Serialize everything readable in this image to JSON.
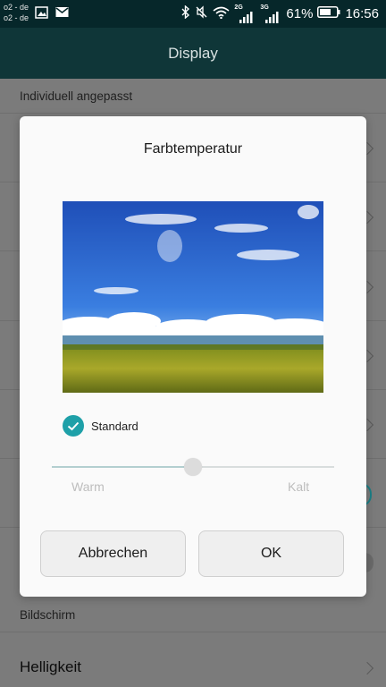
{
  "status_bar": {
    "carrier_line1": "o2 - de",
    "carrier_line2": "o2 - de",
    "net_1": "2G",
    "net_2": "3G",
    "battery_percent": "61%",
    "time": "16:56"
  },
  "app_bar": {
    "title": "Display"
  },
  "list": {
    "section_custom": "Individuell angepasst",
    "section_screen": "Bildschirm",
    "brightness_label": "Helligkeit"
  },
  "dialog": {
    "title": "Farbtemperatur",
    "standard_label": "Standard",
    "standard_checked": true,
    "slider_value": 0.5,
    "warm_label": "Warm",
    "cold_label": "Kalt",
    "cancel_label": "Abbrechen",
    "ok_label": "OK",
    "accent_color": "#1ea0a8"
  }
}
